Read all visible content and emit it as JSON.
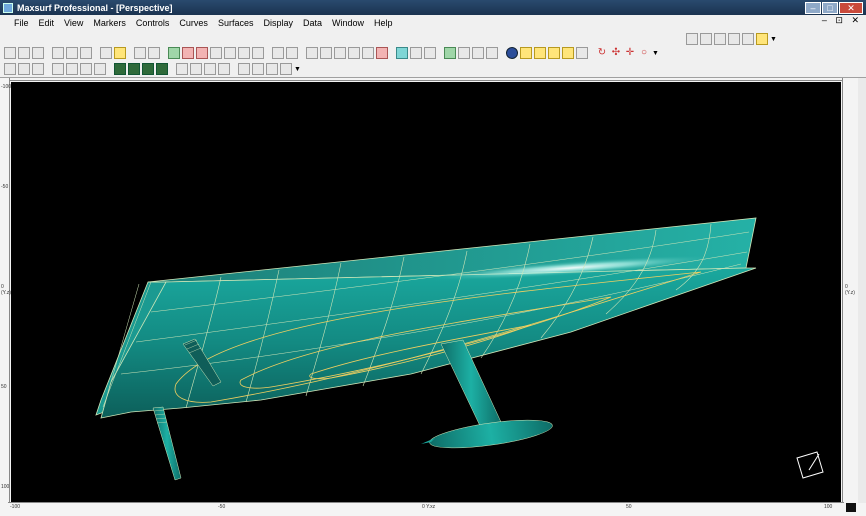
{
  "window": {
    "title": "Maxsurf Professional - [Perspective]",
    "minimize": "–",
    "maximize": "□",
    "close": "✕"
  },
  "menubar": {
    "items": [
      "File",
      "Edit",
      "View",
      "Markers",
      "Controls",
      "Curves",
      "Surfaces",
      "Display",
      "Data",
      "Window",
      "Help"
    ],
    "mdi_controls": "– ⊡ ✕"
  },
  "rulers": {
    "left": [
      "-100",
      "-50",
      "0 (Y.z)",
      "50",
      "100"
    ],
    "right": [
      "0 (Y.z)"
    ],
    "bottom": [
      "-100",
      "-50",
      "0 Y.xz",
      "50",
      "100"
    ]
  },
  "viewport": {
    "background": "#000000",
    "hull_color": "#1fa39a",
    "grid_color": "#c9dfb0",
    "contour_color": "#f0d060"
  }
}
